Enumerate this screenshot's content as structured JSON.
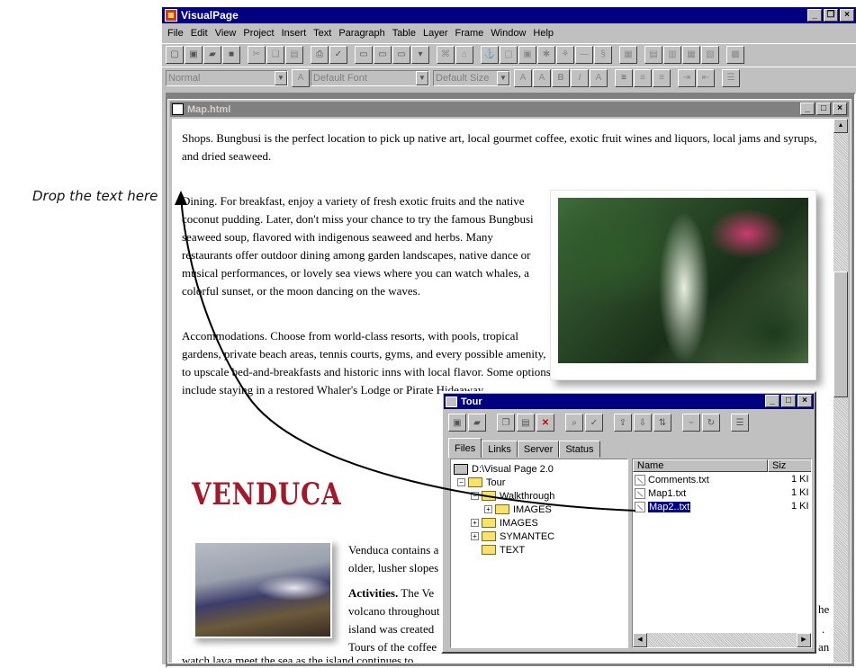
{
  "callout": "Drop the text here",
  "app": {
    "title": "VisualPage",
    "menu": [
      "File",
      "Edit",
      "View",
      "Project",
      "Insert",
      "Text",
      "Paragraph",
      "Table",
      "Layer",
      "Frame",
      "Window",
      "Help"
    ],
    "format_bar": {
      "paragraph_style": "Normal",
      "font": "Default Font",
      "size": "Default Size"
    }
  },
  "document": {
    "title": "Map.html",
    "p1": "Shops. Bungbusi is the perfect location to pick up native art, local gourmet coffee, exotic fruit wines and liquors, local jams and syrups, and dried seaweed.",
    "p2": "Dining. For breakfast, enjoy a variety of fresh exotic fruits and the native coconut pudding. Later, don't miss your chance to try the famous Bungbusi seaweed soup, flavored with indigenous seaweed and herbs. Many restaurants offer outdoor dining among garden landscapes, native dance or musical performances, or lovely sea views where you can watch whales, a colorful sunset, or the moon dancing on the waves.",
    "p3": "Accommodations. Choose from world-class resorts, with pools, tropical gardens, private beach areas, tennis courts, gyms, and every possible amenity, to upscale bed-and-breakfasts and historic inns with local flavor. Some options include staying in a restored Whaler's Lodge or Pirate Hideaway.",
    "venduca_heading": "VENDUCA",
    "venduca_lines": [
      "Venduca contains a",
      "older, lusher slopes"
    ],
    "activities_label": "Activities.",
    "activities_lines": [
      "The Ve",
      "volcano throughout",
      "island was created",
      "Tours of the coffee"
    ],
    "right_fragments": [
      "he",
      ".",
      "an"
    ],
    "bottom_line": "watch lava meet the sea as the island continues to"
  },
  "tour": {
    "title": "Tour",
    "tabs": [
      "Files",
      "Links",
      "Server",
      "Status"
    ],
    "active_tab": "Files",
    "tree": [
      {
        "label": "D:\\Visual Page 2.0",
        "type": "drive"
      },
      {
        "label": "Tour",
        "type": "folder"
      },
      {
        "label": "Walkthrough",
        "type": "folder"
      },
      {
        "label": "IMAGES",
        "type": "folder"
      },
      {
        "label": "IMAGES",
        "type": "folder"
      },
      {
        "label": "SYMANTEC",
        "type": "folder"
      },
      {
        "label": "TEXT",
        "type": "folder"
      }
    ],
    "columns": [
      "Name",
      "Siz"
    ],
    "files": [
      {
        "name": "Comments.txt",
        "size": "1 KI",
        "selected": false
      },
      {
        "name": "Map1.txt",
        "size": "1 KI",
        "selected": false
      },
      {
        "name": "Map2..txt",
        "size": "1 KI",
        "selected": true
      }
    ]
  },
  "icons": {
    "app": "visualpage-app-icon",
    "doc": "html-document-icon",
    "tour": "site-window-icon",
    "drag_arrow": "drag-arrow"
  }
}
